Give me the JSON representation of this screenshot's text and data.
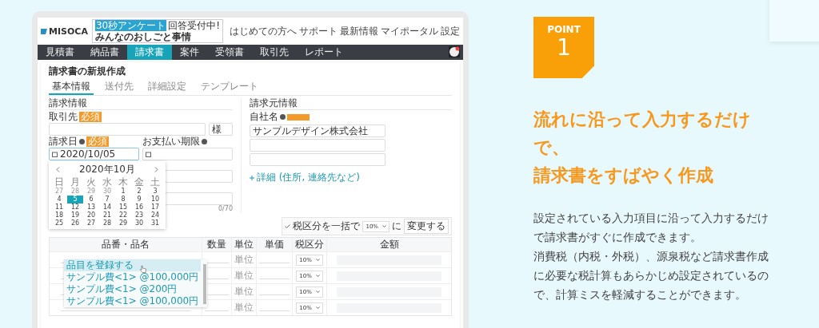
{
  "app": {
    "logo": "MISOCA",
    "banner": {
      "tag": "30秒アンケート",
      "text": "回答受付中!",
      "title": "みんなのおしごと事情"
    },
    "header_links": [
      "はじめての方へ",
      "サポート",
      "最新情報",
      "マイポータル",
      "設定"
    ],
    "nav": [
      {
        "label": "見積書",
        "selected": false
      },
      {
        "label": "納品書",
        "selected": false
      },
      {
        "label": "請求書",
        "selected": true
      },
      {
        "label": "案件",
        "selected": false
      },
      {
        "label": "受領書",
        "selected": false
      },
      {
        "label": "取引先",
        "selected": false
      },
      {
        "label": "レポート",
        "selected": false
      }
    ],
    "page_title": "請求書の新規作成",
    "tabs": [
      {
        "label": "基本情報",
        "selected": true
      },
      {
        "label": "送付先",
        "selected": false
      },
      {
        "label": "詳細設定",
        "selected": false
      },
      {
        "label": "テンプレート",
        "selected": false
      }
    ],
    "billing": {
      "title": "請求情報",
      "client_label": "取引先",
      "required": "必須",
      "honorific": "様",
      "date_label": "請求日",
      "date_required": "必須",
      "date_value": "2020/10/05",
      "due_label": "お支払い期限",
      "counter": "0/70"
    },
    "calendar": {
      "month": "2020年10月",
      "weekdays": [
        "日",
        "月",
        "火",
        "水",
        "木",
        "金",
        "土"
      ],
      "days": [
        {
          "d": "27",
          "muted": true,
          "selected": false
        },
        {
          "d": "28",
          "muted": true,
          "selected": false
        },
        {
          "d": "29",
          "muted": true,
          "selected": false
        },
        {
          "d": "30",
          "muted": true,
          "selected": false
        },
        {
          "d": "1",
          "muted": false,
          "selected": false
        },
        {
          "d": "2",
          "muted": false,
          "selected": false
        },
        {
          "d": "3",
          "muted": false,
          "selected": false
        },
        {
          "d": "4",
          "muted": false,
          "selected": false
        },
        {
          "d": "5",
          "muted": false,
          "selected": true
        },
        {
          "d": "6",
          "muted": false,
          "selected": false
        },
        {
          "d": "7",
          "muted": false,
          "selected": false
        },
        {
          "d": "8",
          "muted": false,
          "selected": false
        },
        {
          "d": "9",
          "muted": false,
          "selected": false
        },
        {
          "d": "10",
          "muted": false,
          "selected": false
        },
        {
          "d": "11",
          "muted": false,
          "selected": false
        },
        {
          "d": "12",
          "muted": false,
          "selected": false
        },
        {
          "d": "13",
          "muted": false,
          "selected": false
        },
        {
          "d": "14",
          "muted": false,
          "selected": false
        },
        {
          "d": "15",
          "muted": false,
          "selected": false
        },
        {
          "d": "16",
          "muted": false,
          "selected": false
        },
        {
          "d": "17",
          "muted": false,
          "selected": false
        },
        {
          "d": "18",
          "muted": false,
          "selected": false
        },
        {
          "d": "19",
          "muted": false,
          "selected": false
        },
        {
          "d": "20",
          "muted": false,
          "selected": false
        },
        {
          "d": "21",
          "muted": false,
          "selected": false
        },
        {
          "d": "22",
          "muted": false,
          "selected": false
        },
        {
          "d": "23",
          "muted": false,
          "selected": false
        },
        {
          "d": "24",
          "muted": false,
          "selected": false
        },
        {
          "d": "25",
          "muted": false,
          "selected": false
        },
        {
          "d": "26",
          "muted": false,
          "selected": false
        },
        {
          "d": "27",
          "muted": false,
          "selected": false
        },
        {
          "d": "28",
          "muted": false,
          "selected": false
        },
        {
          "d": "29",
          "muted": false,
          "selected": false
        },
        {
          "d": "30",
          "muted": false,
          "selected": false
        },
        {
          "d": "31",
          "muted": false,
          "selected": false
        }
      ]
    },
    "sender": {
      "title": "請求元情報",
      "company_label": "自社名",
      "company_value": "サンプルデザイン株式会社",
      "details_link": "詳細 (住所, 連絡先など)"
    },
    "tax_toolbar": {
      "label": "税区分を一括で",
      "rate": "10%",
      "particle": "に",
      "button": "変更する"
    },
    "table": {
      "columns": [
        "品番・品名",
        "数量",
        "単位",
        "単価",
        "税区分",
        "金額"
      ],
      "rows": [
        {
          "unit_placeholder": "単位",
          "tax": "10%"
        },
        {
          "unit_placeholder": "単位",
          "tax": "10%"
        },
        {
          "unit_placeholder": "単位",
          "tax": "10%"
        },
        {
          "unit_placeholder": "単位",
          "tax": "10%"
        }
      ]
    },
    "suggestions": [
      {
        "label": "品目を登録する",
        "selected": true
      },
      {
        "label": "サンプル費<1> @100,000円",
        "selected": false
      },
      {
        "label": "サンプル費<1> @200円",
        "selected": false
      },
      {
        "label": "サンプル費<1> @100,000円",
        "selected": false
      }
    ]
  },
  "point": {
    "label": "POINT",
    "number": "1",
    "heading": [
      "流れに沿って入力するだけで、",
      "請求書をすばやく作成"
    ],
    "paragraphs": [
      "設定されている入力項目に沿って入力するだけで請求書がすぐに作成できます。",
      "消費税（内税・外税）、源泉税など請求書作成に必要な税計算もあらかじめ設定されているので、計算ミスを軽減することができます。"
    ]
  }
}
